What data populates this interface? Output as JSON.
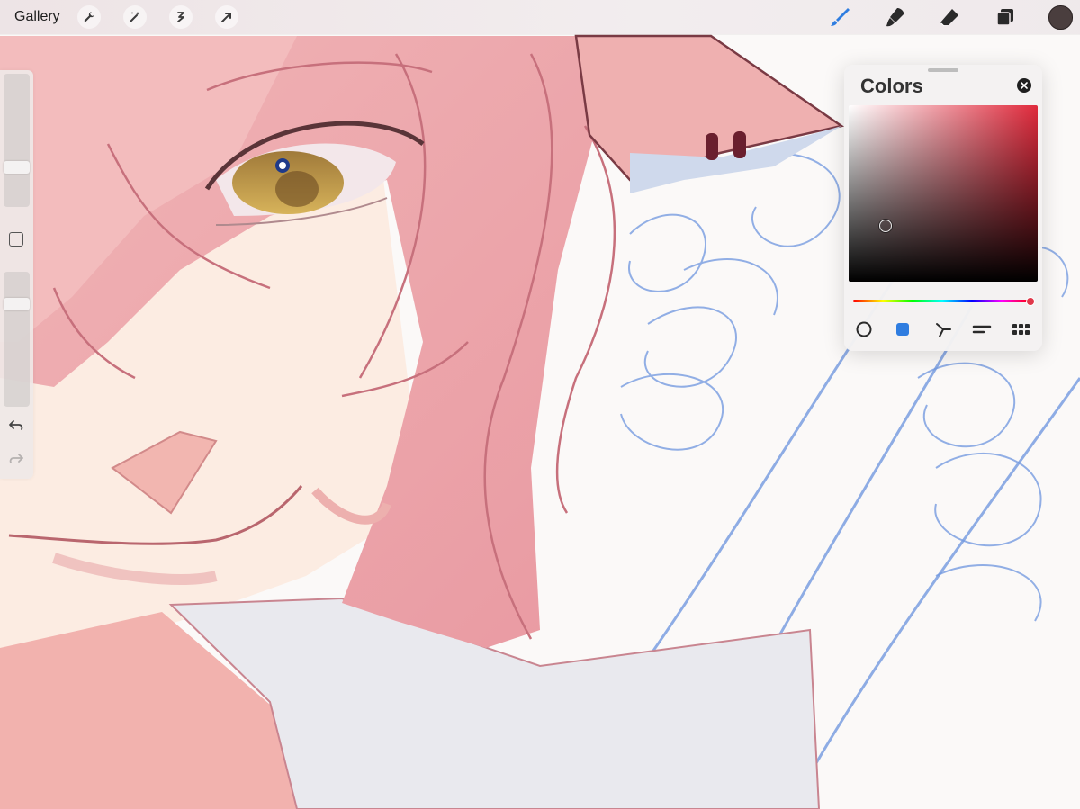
{
  "toolbar": {
    "gallery_label": "Gallery",
    "left_icons": [
      "wrench-icon",
      "magic-wand-icon",
      "selection-icon",
      "transform-icon"
    ],
    "right_icons": [
      "brush-icon",
      "smudge-icon",
      "eraser-icon",
      "layers-icon"
    ],
    "active_tool": "brush",
    "current_color": "#4a3e3e"
  },
  "sidebar": {
    "brush_size_level": 0.25,
    "brush_opacity_level": 0.25,
    "controls": [
      "modify-button",
      "undo-icon",
      "redo-icon"
    ]
  },
  "colors_panel": {
    "title": "Colors",
    "selected_mode": "classic",
    "modes": [
      "disc",
      "classic",
      "harmony",
      "value",
      "palettes"
    ],
    "hue_color": "#e02a3c"
  },
  "accent": "#2f7de0"
}
